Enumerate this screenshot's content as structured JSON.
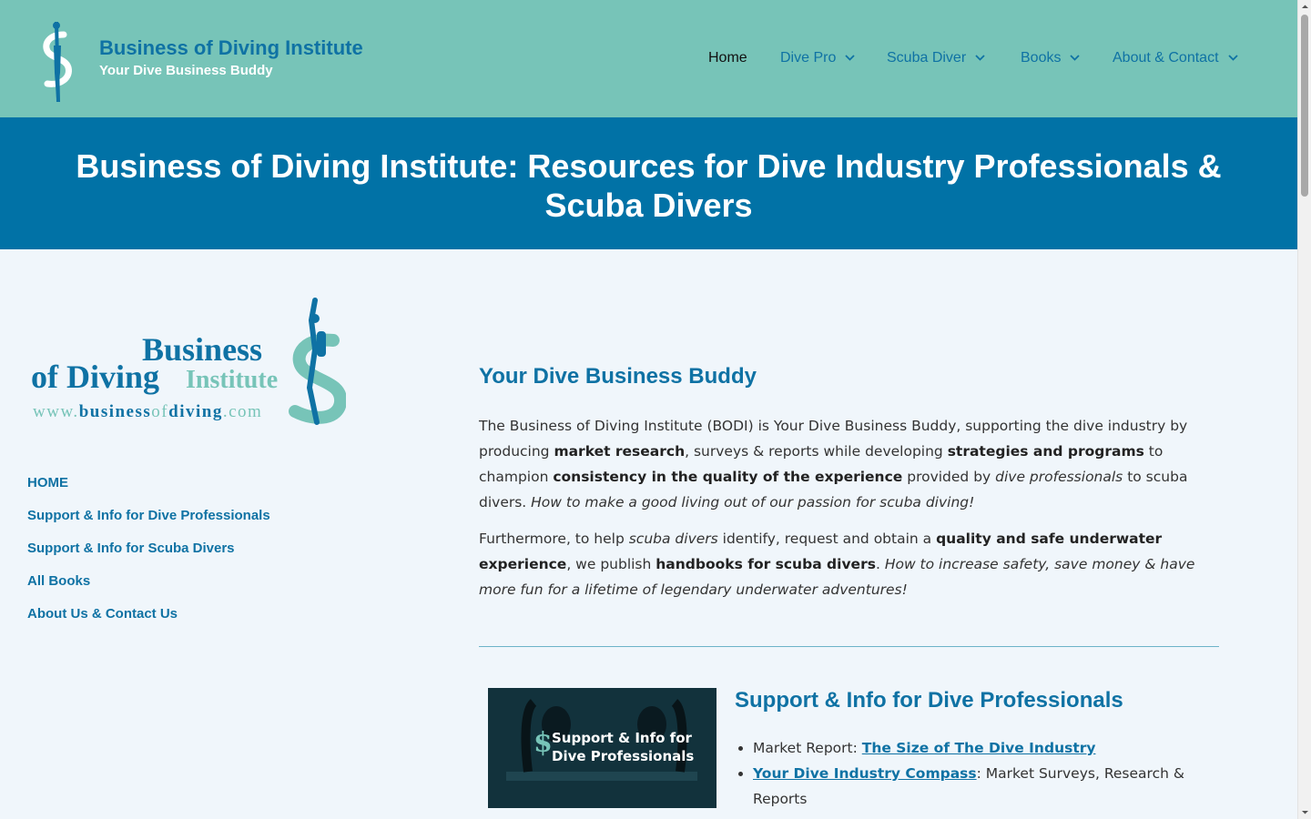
{
  "header": {
    "brand_title": "Business of Diving Institute",
    "brand_tagline": "Your Dive Business Buddy",
    "nav": [
      {
        "label": "Home",
        "active": true
      },
      {
        "label": "Dive Pro",
        "dropdown": true
      },
      {
        "label": "Scuba Diver",
        "dropdown": true
      },
      {
        "label": "Books",
        "dropdown": true
      },
      {
        "label": "About & Contact",
        "dropdown": true
      }
    ]
  },
  "hero": {
    "title": "Business of Diving Institute: Resources for Dive Industry Professionals & Scuba Divers"
  },
  "sidebar": {
    "logo": {
      "line1": "Business",
      "line2a": "of Diving",
      "line2b": "Institute",
      "url_a": "www.",
      "url_b": "business",
      "url_c": "of",
      "url_d": "diving",
      "url_e": ".com"
    },
    "links": [
      "HOME",
      "Support & Info for Dive Professionals",
      "Support & Info for Scuba Divers",
      "All Books",
      "About Us & Contact Us"
    ]
  },
  "main": {
    "heading": "Your Dive Business Buddy",
    "p1": {
      "t1": "The Business of Diving Institute (BODI) is Your Dive Business Buddy, supporting the dive industry by producing ",
      "b1": "market research",
      "t2": ", surveys & reports while developing ",
      "b2": "strategies and programs",
      "t3": " to champion ",
      "b3": "consistency in the quality of the experience",
      "t4": " provided by ",
      "i1": "dive professionals",
      "t5": " to scuba divers. ",
      "i2": "How to make a good living out of our passion for scuba diving!"
    },
    "p2": {
      "t1": "Furthermore, to help ",
      "i1": "scuba divers",
      "t2": " identify, request and obtain a ",
      "b1": "quality and safe underwater experience",
      "t3": ", we publish ",
      "b2": "handbooks for scuba divers",
      "t4": ". ",
      "i2": "How to increase safety, save money & have more fun for a lifetime of legendary underwater adventures!"
    }
  },
  "card": {
    "image_text_line1": "Support & Info for",
    "image_text_line2": "Dive Professionals",
    "title": "Support & Info for Dive Professionals",
    "items": [
      {
        "prefix": "Market Report: ",
        "link": "The Size of The Dive Industry",
        "suffix": ""
      },
      {
        "prefix": "",
        "link": "Your Dive Industry Compass",
        "suffix": ": Market Surveys, Research & Reports"
      }
    ]
  },
  "colors": {
    "header_bg": "#77c4b8",
    "hero_bg": "#0172a6",
    "accent": "#0f72a4",
    "page_bg": "#f0f6fb"
  }
}
